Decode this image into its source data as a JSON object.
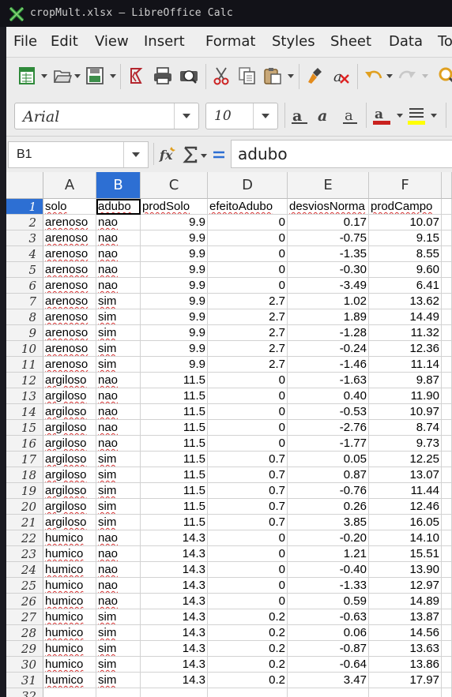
{
  "window": {
    "title": "cropMult.xlsx — LibreOffice Calc"
  },
  "menu": [
    "File",
    "Edit",
    "View",
    "Insert",
    "Format",
    "Styles",
    "Sheet",
    "Data",
    "To"
  ],
  "format": {
    "font_name": "Arial",
    "font_size": "10"
  },
  "formula_bar": {
    "name_box": "B1",
    "content": "adubo"
  },
  "sheet": {
    "columns": [
      "A",
      "B",
      "C",
      "D",
      "E",
      "F"
    ],
    "selected_column": "B",
    "header_row": [
      "solo",
      "adubo",
      "prodSolo",
      "efeitoAdubo",
      "desviosNorma",
      "prodCampo"
    ],
    "rows": [
      [
        "arenoso",
        "nao",
        "9.9",
        "0",
        "0.17",
        "10.07"
      ],
      [
        "arenoso",
        "nao",
        "9.9",
        "0",
        "-0.75",
        "9.15"
      ],
      [
        "arenoso",
        "nao",
        "9.9",
        "0",
        "-1.35",
        "8.55"
      ],
      [
        "arenoso",
        "nao",
        "9.9",
        "0",
        "-0.30",
        "9.60"
      ],
      [
        "arenoso",
        "nao",
        "9.9",
        "0",
        "-3.49",
        "6.41"
      ],
      [
        "arenoso",
        "sim",
        "9.9",
        "2.7",
        "1.02",
        "13.62"
      ],
      [
        "arenoso",
        "sim",
        "9.9",
        "2.7",
        "1.89",
        "14.49"
      ],
      [
        "arenoso",
        "sim",
        "9.9",
        "2.7",
        "-1.28",
        "11.32"
      ],
      [
        "arenoso",
        "sim",
        "9.9",
        "2.7",
        "-0.24",
        "12.36"
      ],
      [
        "arenoso",
        "sim",
        "9.9",
        "2.7",
        "-1.46",
        "11.14"
      ],
      [
        "argiloso",
        "nao",
        "11.5",
        "0",
        "-1.63",
        "9.87"
      ],
      [
        "argiloso",
        "nao",
        "11.5",
        "0",
        "0.40",
        "11.90"
      ],
      [
        "argiloso",
        "nao",
        "11.5",
        "0",
        "-0.53",
        "10.97"
      ],
      [
        "argiloso",
        "nao",
        "11.5",
        "0",
        "-2.76",
        "8.74"
      ],
      [
        "argiloso",
        "nao",
        "11.5",
        "0",
        "-1.77",
        "9.73"
      ],
      [
        "argiloso",
        "sim",
        "11.5",
        "0.7",
        "0.05",
        "12.25"
      ],
      [
        "argiloso",
        "sim",
        "11.5",
        "0.7",
        "0.87",
        "13.07"
      ],
      [
        "argiloso",
        "sim",
        "11.5",
        "0.7",
        "-0.76",
        "11.44"
      ],
      [
        "argiloso",
        "sim",
        "11.5",
        "0.7",
        "0.26",
        "12.46"
      ],
      [
        "argiloso",
        "sim",
        "11.5",
        "0.7",
        "3.85",
        "16.05"
      ],
      [
        "humico",
        "nao",
        "14.3",
        "0",
        "-0.20",
        "14.10"
      ],
      [
        "humico",
        "nao",
        "14.3",
        "0",
        "1.21",
        "15.51"
      ],
      [
        "humico",
        "nao",
        "14.3",
        "0",
        "-0.40",
        "13.90"
      ],
      [
        "humico",
        "nao",
        "14.3",
        "0",
        "-1.33",
        "12.97"
      ],
      [
        "humico",
        "nao",
        "14.3",
        "0",
        "0.59",
        "14.89"
      ],
      [
        "humico",
        "sim",
        "14.3",
        "0.2",
        "-0.63",
        "13.87"
      ],
      [
        "humico",
        "sim",
        "14.3",
        "0.2",
        "0.06",
        "14.56"
      ],
      [
        "humico",
        "sim",
        "14.3",
        "0.2",
        "-0.87",
        "13.63"
      ],
      [
        "humico",
        "sim",
        "14.3",
        "0.2",
        "-0.64",
        "13.86"
      ],
      [
        "humico",
        "sim",
        "14.3",
        "0.2",
        "3.47",
        "17.97"
      ]
    ],
    "row_numbers": [
      "1",
      "2",
      "3",
      "4",
      "5",
      "6",
      "7",
      "8",
      "9",
      "10",
      "11",
      "12",
      "13",
      "14",
      "15",
      "16",
      "17",
      "18",
      "19",
      "20",
      "21",
      "22",
      "23",
      "24",
      "25",
      "26",
      "27",
      "28",
      "29",
      "30",
      "31",
      "32"
    ]
  },
  "colors": {
    "selection": "#2d6fd3",
    "titlebar": "#121218"
  }
}
